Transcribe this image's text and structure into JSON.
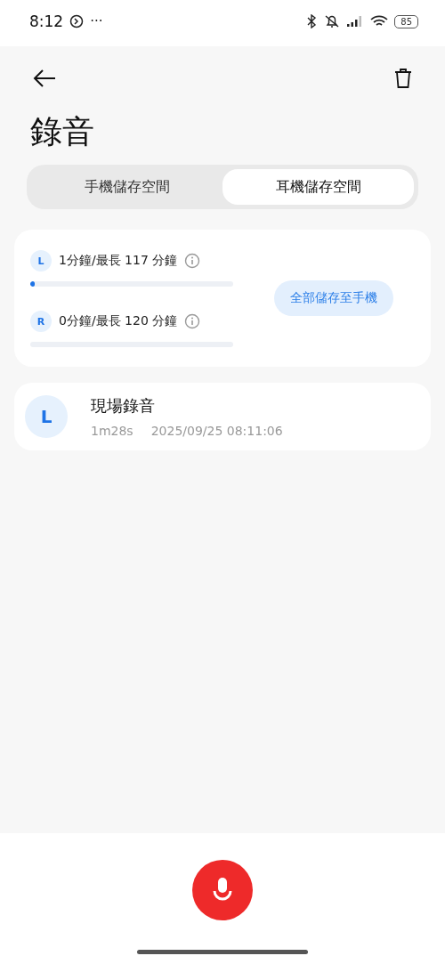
{
  "status_bar": {
    "time": "8:12",
    "more": "···",
    "battery": "85"
  },
  "title": "錄音",
  "tabs": [
    {
      "label": "手機儲存空間",
      "selected": false
    },
    {
      "label": "耳機儲存空間",
      "selected": true
    }
  ],
  "storage": {
    "channels": [
      {
        "badge": "L",
        "text": "1分鐘/最長 117 分鐘",
        "level": 0.02
      },
      {
        "badge": "R",
        "text": "0分鐘/最長 120 分鐘",
        "level": 0
      }
    ],
    "save_button": "全部儲存至手機"
  },
  "recordings": [
    {
      "badge": "L",
      "name": "現場錄音",
      "duration": "1m28s",
      "date": "2025/09/25 08:11:06"
    }
  ]
}
